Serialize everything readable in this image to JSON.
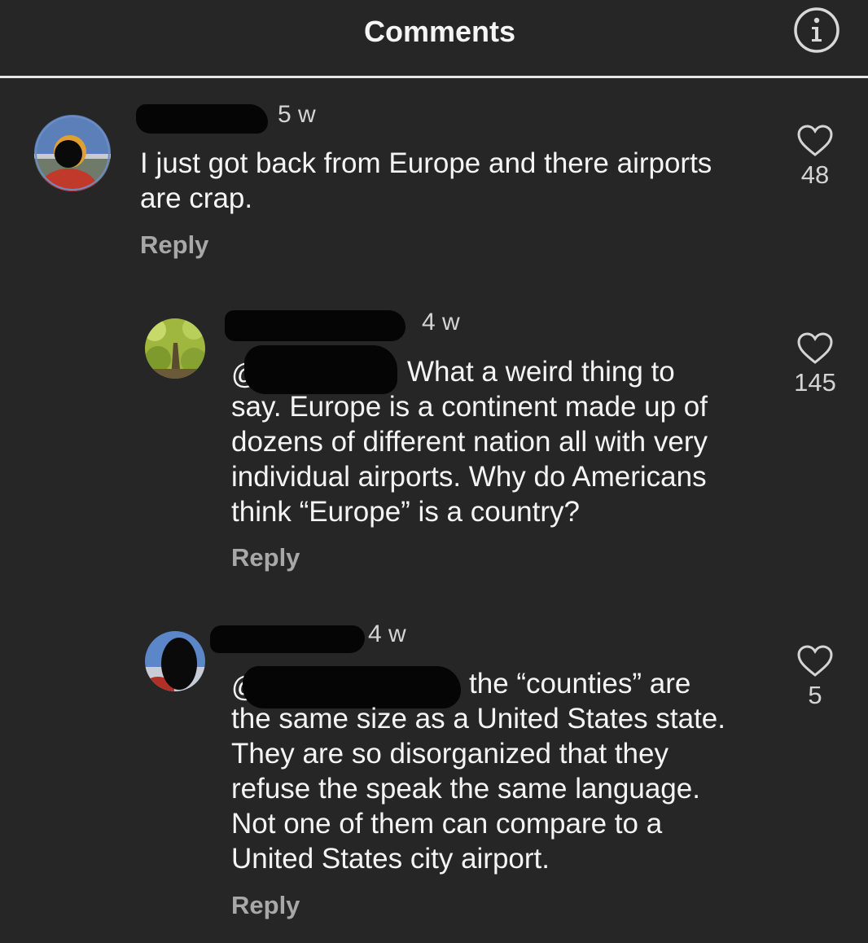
{
  "header": {
    "title": "Comments",
    "info_icon": "info-circle-icon"
  },
  "comments": [
    {
      "time": "5 w",
      "mention_prefix": "",
      "text": "I just got back from Europe and there airports\nare crap.",
      "reply_label": "Reply",
      "likes": "48",
      "like_icon": "heart-outline-icon"
    },
    {
      "time": "4 w",
      "mention_prefix": "@",
      "text": "What a weird thing to\nsay. Europe is a continent made up of\ndozens of different nation all with very\nindividual airports. Why do Americans\nthink “Europe” is a country?",
      "reply_label": "Reply",
      "likes": "145",
      "like_icon": "heart-outline-icon"
    },
    {
      "time": "4 w",
      "mention_prefix": "@",
      "text": "the “counties” are\nthe same size as a United States state.\nThey are so disorganized that they\nrefuse the speak the same language.\nNot one of them can compare to a\nUnited States city airport.",
      "reply_label": "Reply",
      "likes": "5",
      "like_icon": "heart-outline-icon"
    }
  ],
  "colors": {
    "background": "#262626",
    "text": "#f4f4f4",
    "muted": "#a8a8a8"
  }
}
